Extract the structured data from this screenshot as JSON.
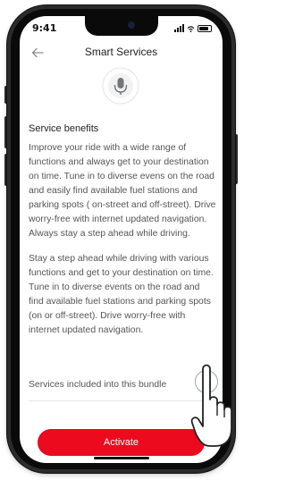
{
  "status_bar": {
    "time": "9:41"
  },
  "header": {
    "title": "Smart Services",
    "back_icon": "arrow-left-icon"
  },
  "hero_icon": "microphone-icon",
  "section": {
    "title": "Service benefits",
    "paragraphs": [
      "Improve your ride with a wide range of functions and always get to your destination on time. Tune in to diverse evens on the road and easily find available fuel stations and parking spots ( on-street and off-street). Drive worry-free with internet updated navigation. Always stay a step ahead while driving.",
      "Stay a step ahead while driving with various functions and get to your destination on time. Tune in to diverse events on the road and find available fuel stations and parking spots (on or off-street). Drive worry-free with internet updated navigation."
    ]
  },
  "bundle": {
    "label": "Services included into this bundle",
    "icon": "chevron-right-icon"
  },
  "activate_button": {
    "label": "Activate"
  },
  "colors": {
    "accent": "#eb0a1e",
    "text": "#555555",
    "title": "#222222"
  }
}
